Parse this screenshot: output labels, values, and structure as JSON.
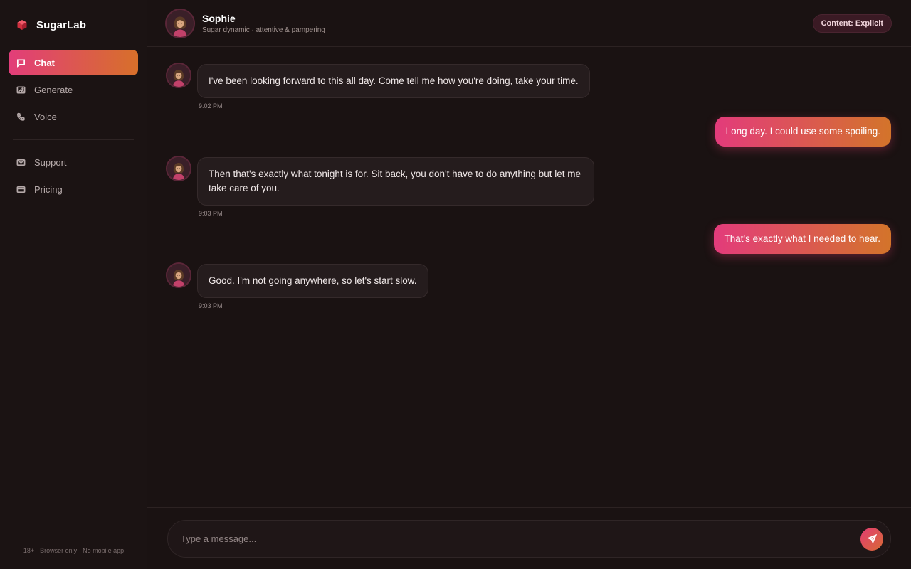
{
  "brand": {
    "name": "SugarLab"
  },
  "sidebar": {
    "nav": [
      {
        "label": "Chat",
        "icon": "chat-icon",
        "active": true
      },
      {
        "label": "Generate",
        "icon": "image-icon"
      },
      {
        "label": "Voice",
        "icon": "phone-icon"
      }
    ],
    "secondary": [
      {
        "label": "Support",
        "icon": "mail-icon"
      },
      {
        "label": "Pricing",
        "icon": "card-icon"
      }
    ],
    "footer": "18+ · Browser only · No mobile app"
  },
  "header": {
    "name": "Sophie",
    "subtitle": "Sugar dynamic · attentive & pampering",
    "badge": "Content: Explicit"
  },
  "messages": [
    {
      "from": "bot",
      "text": "I've been looking forward to this all day. Come tell me how you're doing, take your time.",
      "time": "9:02 PM"
    },
    {
      "from": "user",
      "text": "Long day. I could use some spoiling."
    },
    {
      "from": "bot",
      "text": "Then that's exactly what tonight is for. Sit back, you don't have to do anything but let me take care of you.",
      "time": "9:03 PM"
    },
    {
      "from": "user",
      "text": "That's exactly what I needed to hear."
    },
    {
      "from": "bot",
      "text": "Good. I'm not going anywhere, so let's start slow.",
      "time": "9:03 PM"
    }
  ],
  "composer": {
    "placeholder": "Type a message..."
  },
  "colors": {
    "accent_start": "#e23d7a",
    "accent_end": "#d7702a",
    "background": "#1a1212"
  }
}
